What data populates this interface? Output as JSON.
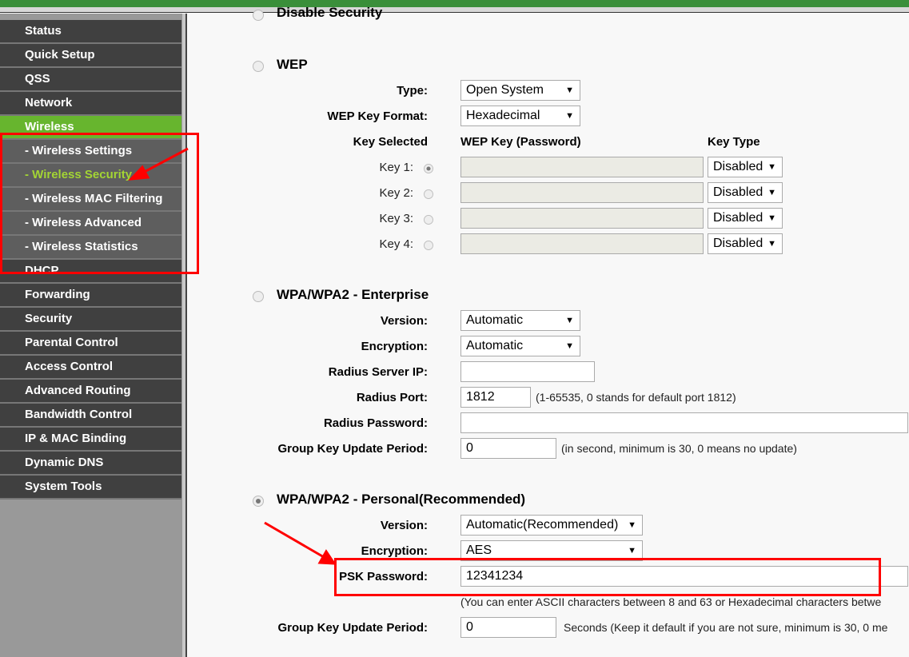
{
  "sidebar": {
    "items": [
      "Status",
      "Quick Setup",
      "QSS",
      "Network",
      "Wireless",
      "- Wireless Settings",
      "- Wireless Security",
      "- Wireless MAC Filtering",
      "- Wireless Advanced",
      "- Wireless Statistics",
      "DHCP",
      "Forwarding",
      "Security",
      "Parental Control",
      "Access Control",
      "Advanced Routing",
      "Bandwidth Control",
      "IP & MAC Binding",
      "Dynamic DNS",
      "System Tools"
    ],
    "active": "Wireless",
    "current": "- Wireless Security"
  },
  "disable": {
    "label": "Disable Security"
  },
  "wep": {
    "label": "WEP",
    "type_label": "Type:",
    "type_value": "Open System",
    "format_label": "WEP Key Format:",
    "format_value": "Hexadecimal",
    "col_key_selected": "Key Selected",
    "col_key": "WEP Key (Password)",
    "col_key_type": "Key Type",
    "keys": [
      {
        "label": "Key 1:",
        "type": "Disabled"
      },
      {
        "label": "Key 2:",
        "type": "Disabled"
      },
      {
        "label": "Key 3:",
        "type": "Disabled"
      },
      {
        "label": "Key 4:",
        "type": "Disabled"
      }
    ]
  },
  "enterprise": {
    "label": "WPA/WPA2 - Enterprise",
    "version_label": "Version:",
    "version_value": "Automatic",
    "encryption_label": "Encryption:",
    "encryption_value": "Automatic",
    "radius_ip_label": "Radius Server IP:",
    "radius_ip_value": "",
    "radius_port_label": "Radius Port:",
    "radius_port_value": "1812",
    "radius_port_note": "(1-65535, 0 stands for default port 1812)",
    "radius_password_label": "Radius Password:",
    "group_label": "Group Key Update Period:",
    "group_value": "0",
    "group_note": "(in second, minimum is 30, 0 means no update)"
  },
  "personal": {
    "label": "WPA/WPA2 - Personal(Recommended)",
    "version_label": "Version:",
    "version_value": "Automatic(Recommended)",
    "encryption_label": "Encryption:",
    "encryption_value": "AES",
    "psk_label": "PSK Password:",
    "psk_value": "12341234",
    "psk_note": "(You can enter ASCII characters between 8 and 63 or Hexadecimal characters betwe",
    "group_label": "Group Key Update Period:",
    "group_value": "0",
    "group_note": "Seconds (Keep it default if you are not sure, minimum is 30, 0 me"
  },
  "colors": {
    "accent": "#67b52e",
    "highlight": "#ff0000"
  }
}
